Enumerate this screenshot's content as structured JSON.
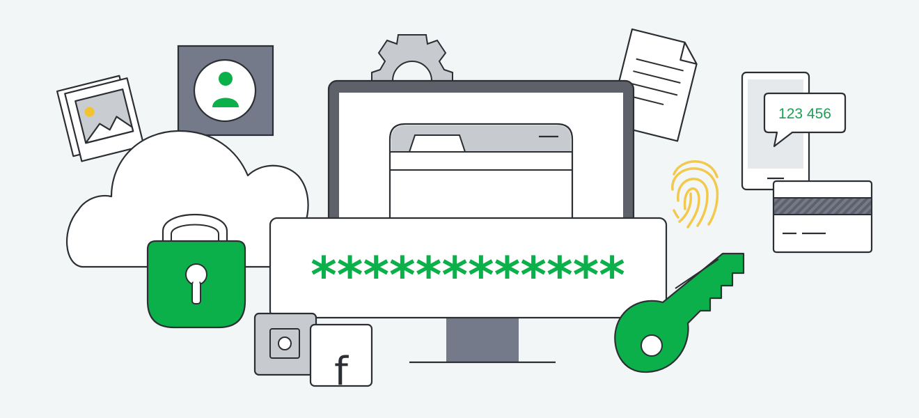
{
  "otp_message": {
    "code": "123 456"
  },
  "password_field": {
    "masked_value": "************"
  },
  "social_tile": {
    "glyph": "f"
  },
  "icons": [
    "cloud-icon",
    "padlock-icon",
    "photo-icon",
    "user-avatar-icon",
    "gear-icon",
    "monitor-icon",
    "browser-window-icon",
    "document-icon",
    "fingerprint-icon",
    "smartphone-icon",
    "chat-bubble-icon",
    "credit-card-icon",
    "key-icon",
    "camera-app-icon",
    "facebook-icon"
  ],
  "colors": {
    "background": "#f3f6f7",
    "outline": "#2b2f33",
    "accent_green": "#0cb04a",
    "code_green": "#1f9e56",
    "slate_gray": "#747a8a",
    "light_gray": "#c7cbcf",
    "mid_gray": "#5e6169",
    "fingerprint_yellow": "#f2c94c",
    "photo_sun": "#f1c232"
  }
}
